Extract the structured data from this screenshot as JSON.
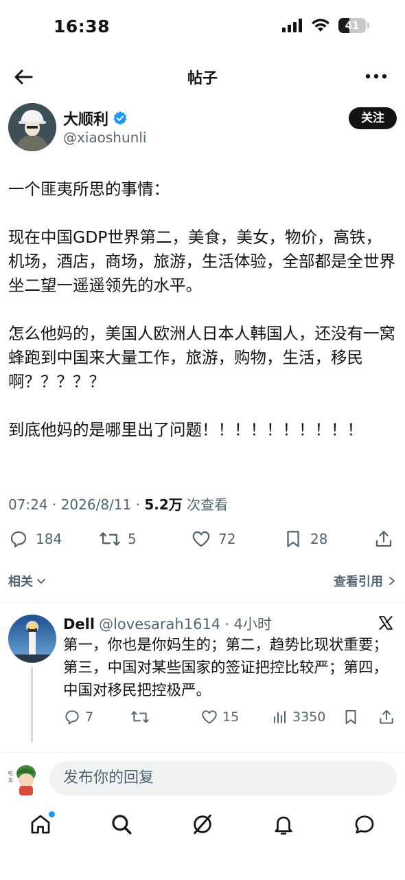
{
  "status_bar": {
    "time": "16:38",
    "battery": "41"
  },
  "header": {
    "title": "帖子"
  },
  "author": {
    "name": "大顺利",
    "handle": "@xiaoshunli",
    "follow_label": "关注"
  },
  "tweet": {
    "paragraphs": [
      "一个匪夷所思的事情：",
      "现在中国GDP世界第二，美食，美女，物价，高铁，机场，酒店，商场，旅游，生活体验，全部都是全世界坐二望一遥遥领先的水平。",
      "怎么他妈的，美国人欧洲人日本人韩国人，还没有一窝蜂跑到中国来大量工作，旅游，购物，生活，移民啊？？？？？",
      "到底他妈的是哪里出了问题！！！！！！！！！！"
    ],
    "time": "07:24 · 2026/8/11 · ",
    "views_count": "5.2万",
    "views_label": " 次查看"
  },
  "actions": {
    "replies": "184",
    "retweets": "5",
    "likes": "72",
    "bookmarks": "28"
  },
  "related": {
    "left_label": "相关",
    "right_label": "查看引用"
  },
  "reply": {
    "name": "Dell",
    "handle": "@lovesarah1614",
    "time": "· 4小时",
    "text": "第一，你也是你妈生的；第二，趋势比现状重要；第三，中国对某些国家的签证把控比较严；第四，中国对移民把控极严。",
    "replies": "7",
    "retweets": "",
    "likes": "15",
    "views": "3350"
  },
  "reply_bar": {
    "placeholder": "发布你的回复"
  },
  "colors": {
    "accent": "#1d9bf0",
    "text": "#0f1419",
    "secondary": "#536471"
  },
  "nav": {
    "icons": [
      "home-icon",
      "search-icon",
      "grok-icon",
      "notifications-icon",
      "messages-icon"
    ]
  }
}
